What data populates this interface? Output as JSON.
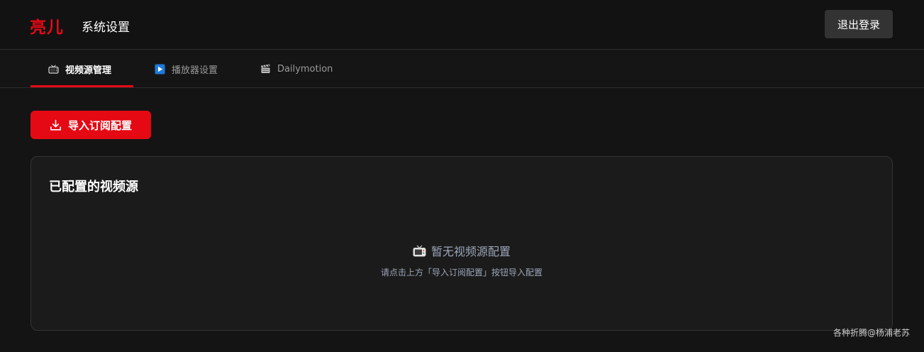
{
  "header": {
    "logo": "亮儿",
    "title": "系统设置",
    "logout_label": "退出登录"
  },
  "tabs": [
    {
      "label": "视频源管理",
      "icon": "tv-icon",
      "active": true
    },
    {
      "label": "播放器设置",
      "icon": "play-icon",
      "active": false
    },
    {
      "label": "Dailymotion",
      "icon": "clapperboard-icon",
      "active": false
    }
  ],
  "toolbar": {
    "import_label": "导入订阅配置",
    "import_icon": "download-icon"
  },
  "panel": {
    "title": "已配置的视频源",
    "empty_title": "暂无视频源配置",
    "empty_hint": "请点击上方「导入订阅配置」按钮导入配置"
  },
  "watermark": "各种折腾@杨浦老苏",
  "colors": {
    "accent": "#e50914",
    "background": "#141414",
    "panel": "#1b1b1b",
    "muted_text": "#9aa6b8"
  }
}
